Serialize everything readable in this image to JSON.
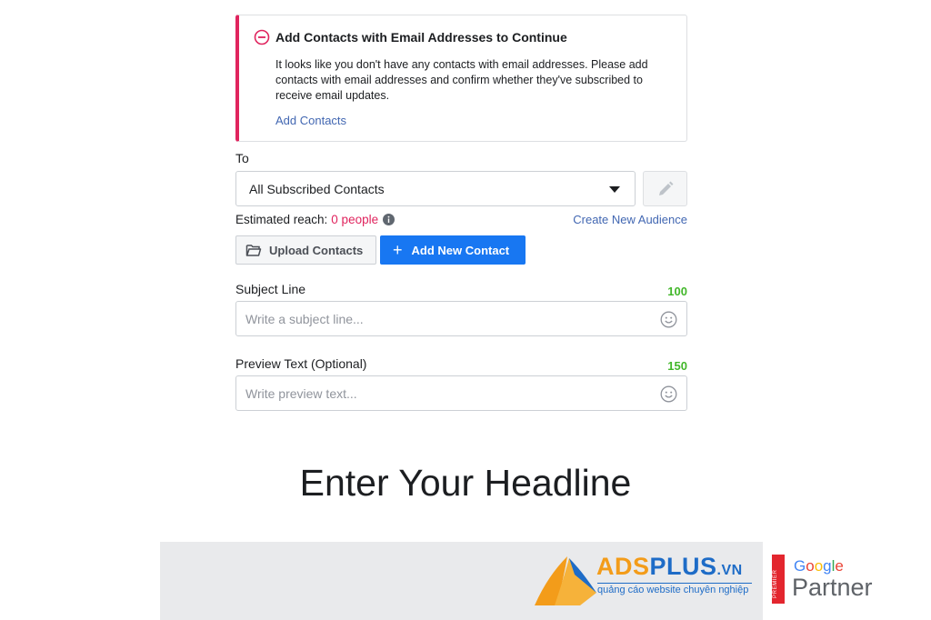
{
  "alert": {
    "title": "Add Contacts with Email Addresses to Continue",
    "body": "It looks like you don't have any contacts with email addresses. Please add contacts with email addresses and confirm whether they've subscribed to receive email updates.",
    "link": "Add Contacts",
    "accent_color": "#e0245e"
  },
  "to": {
    "label": "To",
    "selected": "All Subscribed Contacts"
  },
  "reach": {
    "label": "Estimated reach:",
    "count": "0 people",
    "create_link": "Create New Audience"
  },
  "buttons": {
    "upload": "Upload Contacts",
    "add": "Add New Contact",
    "add_color": "#1877f2"
  },
  "subject": {
    "label": "Subject Line",
    "counter": "100",
    "placeholder": "Write a subject line..."
  },
  "preview": {
    "label": "Preview Text (Optional)",
    "counter": "150",
    "placeholder": "Write preview text..."
  },
  "headline": "Enter Your Headline",
  "footer": {
    "brand_a": "ADS",
    "brand_b": "PLUS",
    "brand_suffix": ".VN",
    "tagline": "quảng cáo website chuyên nghiệp",
    "premier": "PREMIER",
    "google": "Google",
    "partner": "Partner"
  }
}
